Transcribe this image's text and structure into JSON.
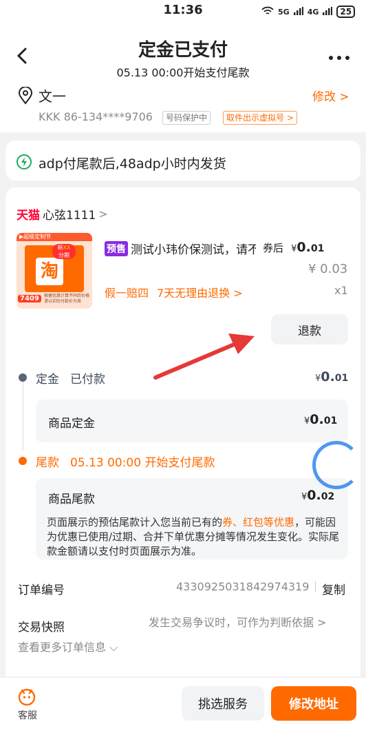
{
  "status": {
    "time": "11:36",
    "battery": "25",
    "signal_a": "5G",
    "signal_b": "4G"
  },
  "header": {
    "title": "定金已支付",
    "subtitle": "05.13 00:00开始支付尾款"
  },
  "address": {
    "name": "文一",
    "edit": "修改 >",
    "phone": "KKK 86-134****9706",
    "privacy_tag": "号码保护中",
    "virtual_tag": "取件出示虚拟号 >"
  },
  "notice": "adp付尾款后,48adp小时内发货",
  "shop": {
    "brand": "天猫",
    "name": "心弦1111",
    "arrow": ">"
  },
  "product": {
    "badge": "预售",
    "title": "测试小玮价保测试，请不",
    "price_prefix": "券后",
    "currency": "¥",
    "price_int": "0.",
    "price_dec": "01",
    "orig_price": "¥ 0.03",
    "promise1": "假一赔四",
    "promise2": "7天无理由退换 >",
    "qty": "x1",
    "thumb": {
      "top": "▶超级定制节",
      "logo": "淘",
      "badge_a": "新",
      "badge_b": "XX",
      "badge_c": "分期",
      "price": "7409",
      "note1": "根据优惠计算不同后价格",
      "note2": "请以实际付款价为准"
    }
  },
  "refund_button": "退款",
  "deposit": {
    "label": "定金",
    "status": "已付款",
    "currency": "¥",
    "amount_int": "0.",
    "amount_dec": "01",
    "inner_label": "商品定金",
    "inner_currency": "¥",
    "inner_int": "0.",
    "inner_dec": "01"
  },
  "balance": {
    "label": "尾款",
    "time": "05.13 00:00 开始支付尾款",
    "inner_label": "商品尾款",
    "currency": "¥",
    "amount_int": "0.",
    "amount_dec": "02",
    "note_pre": "页面展示的预估尾款计入您当前已有的",
    "note_hl": "券、红包等优惠",
    "note_post": "，可能因为优惠已使用/过期、合并下单优惠分摊等情况发生变化。实际尾款金额请以支付时页面展示为准。"
  },
  "order": {
    "number_label": "订单编号",
    "number": "4330925031842974319",
    "copy": "复制",
    "snapshot_label": "交易快照",
    "snapshot_desc": "发生交易争议时，可作为判断依据 >",
    "more": "查看更多订单信息 ⌵"
  },
  "bottom": {
    "service": "客服",
    "select_service": "挑选服务",
    "modify_address": "修改地址"
  },
  "colors": {
    "accent": "#ff6a00",
    "badge": "#8a2be2",
    "tmall": "#ff0036",
    "arrow": "#e53935"
  }
}
